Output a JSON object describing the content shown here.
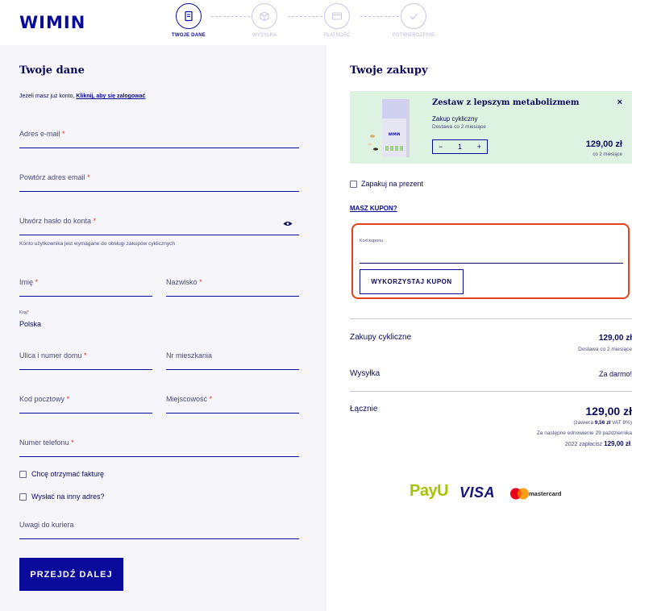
{
  "brand": {
    "logo_text": "WIMIN"
  },
  "steps": [
    {
      "label": "TWOJE DANE",
      "active": true
    },
    {
      "label": "WYSYŁKA",
      "active": false
    },
    {
      "label": "PŁATNOŚĆ",
      "active": false
    },
    {
      "label": "POTWIERDZENIE",
      "active": false
    }
  ],
  "form": {
    "title": "Twoje dane",
    "login_hint_prefix": "Jeżeli masz już konto, ",
    "login_link": "Kliknij, aby się zalogować",
    "email_label": "Adres e-mail",
    "email_repeat_label": "Powtórz adres email",
    "password_label": "Utwórz hasło do konta",
    "password_hint": "Konto użytkownika jest wymagane do obsługi zakupów cyklicznych",
    "first_name_label": "Imię",
    "last_name_label": "Nazwisko",
    "country_label": "Kraj",
    "country_value": "Polska",
    "street_label": "Ulica i numer domu",
    "apartment_label": "Nr mieszkania",
    "postcode_label": "Kod pocztowy",
    "city_label": "Miejscowość",
    "phone_label": "Numer telefonu",
    "invoice_checkbox": "Chcę otrzymać fakturę",
    "other_address_checkbox": "Wysłać na inny adres?",
    "courier_notes_label": "Uwagi do kuriera",
    "required_mark": "*",
    "submit_label": "PRZEJDŹ DALEJ"
  },
  "cart": {
    "title": "Twoje zakupy",
    "product": {
      "name": "Zestaw z lepszym metabolizmem",
      "type": "Zakup cykliczny",
      "frequency": "Dostawa co 2 miesiące",
      "quantity": "1",
      "minus": "−",
      "plus": "+",
      "price": "129,00 zł",
      "price_period": "co 2 miesiące",
      "remove": "×",
      "package_brand": "WIMIN"
    },
    "gift_label": "Zapakuj na prezent",
    "coupon_link": "MASZ KUPON?",
    "coupon_input_label": "Kod kuponu",
    "coupon_button": "WYKORZYSTAJ KUPON",
    "summary": {
      "cyclic_label": "Zakupy cykliczne",
      "cyclic_value": "129,00 zł",
      "cyclic_sub": "Dostawa co 2 miesiące",
      "shipping_label": "Wysyłka",
      "shipping_value": "Za darmo!",
      "total_label": "Łącznie",
      "total_value": "129,00 zł",
      "vat_prefix": "(zawiera ",
      "vat_amount": "9,56 zł",
      "vat_suffix": " VAT 8%)",
      "renewal_line1": "Za następne odnowienie 29 października",
      "renewal_line2_prefix": "2022 zapłacisz ",
      "renewal_amount": "129,00 zł",
      "renewal_line2_suffix": "."
    }
  },
  "payments": {
    "payu": "PayU",
    "visa": "VISA",
    "mastercard": "mastercard"
  },
  "colors": {
    "brand_navy": "#0a0a9a",
    "text_dark": "#0a0a5c",
    "required_red": "#e0301e",
    "coupon_border": "#e2401e",
    "product_bg": "#ddf2e0",
    "left_panel_bg": "#f5f5fa"
  }
}
